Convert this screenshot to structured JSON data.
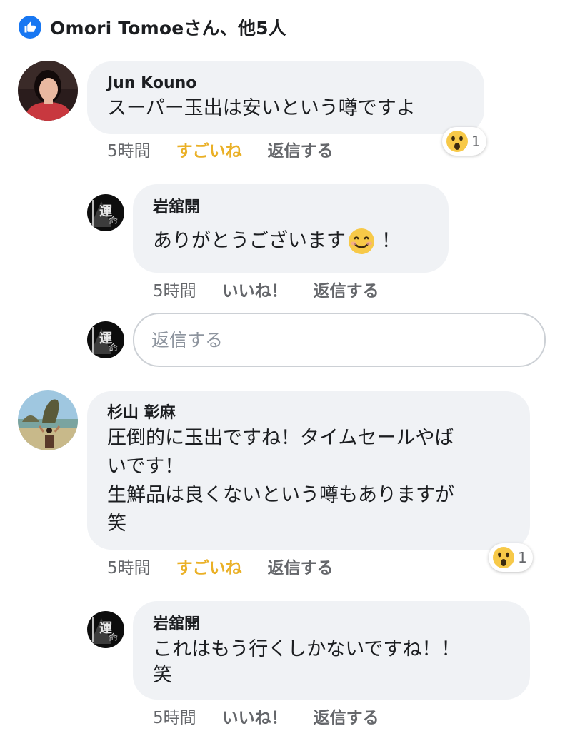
{
  "likes": {
    "summary": "Omori Tomoeさん、他5人",
    "icon": "thumbs-up-icon"
  },
  "comments": [
    {
      "author": "Jun Kouno",
      "lines": [
        "スーパー玉出は安いという噂ですよ"
      ],
      "time": "5時間",
      "reaction_label": "すごいね",
      "reply_label": "返信する",
      "reaction_badge": {
        "icon": "wow-emoji-icon",
        "count": "1"
      },
      "replies": [
        {
          "author": "岩舘開",
          "lines": [
            "ありがとうございます",
            "！"
          ],
          "emoji": "smiling-face-icon",
          "time": "5時間",
          "like_label": "いいね！",
          "reply_label": "返信する"
        }
      ],
      "reply_box": {
        "placeholder": "返信する"
      }
    },
    {
      "author": "杉山 彰麻",
      "lines": [
        "圧倒的に玉出ですね！タイムセールやば",
        "いです！",
        "生鮮品は良くないという噂もありますが",
        "笑"
      ],
      "time": "5時間",
      "reaction_label": "すごいね",
      "reply_label": "返信する",
      "reaction_badge": {
        "icon": "wow-emoji-icon",
        "count": "1"
      },
      "replies": [
        {
          "author": "岩舘開",
          "lines": [
            "これはもう行くしかないですね！！",
            "笑"
          ],
          "time": "5時間",
          "like_label": "いいね！",
          "reply_label": "返信する"
        }
      ]
    }
  ],
  "colors": {
    "accent": "#1877f2",
    "wow": "#eab026",
    "bubble": "#f0f2f5",
    "meta": "#65676b"
  }
}
